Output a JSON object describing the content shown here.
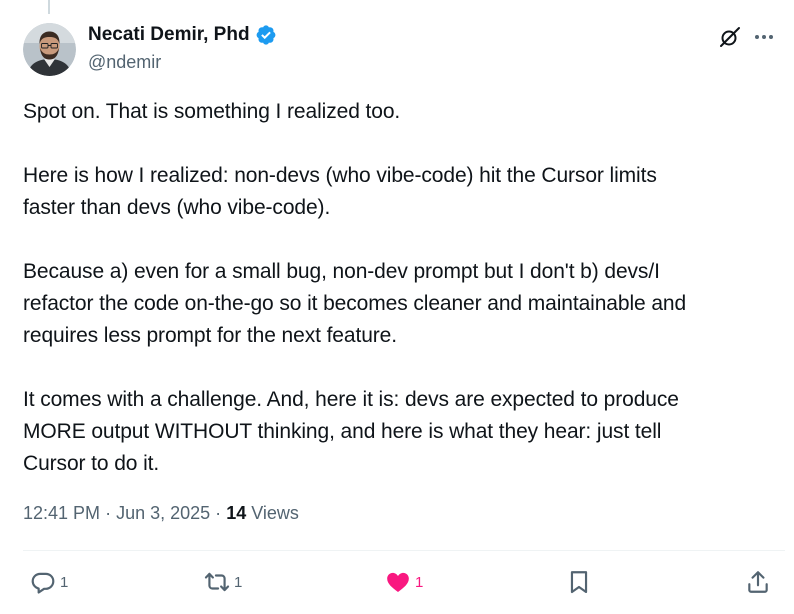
{
  "author": {
    "display_name": "Necati Demir, Phd",
    "handle": "@ndemir",
    "verified": true
  },
  "tweet": {
    "paragraphs": [
      [
        "Spot on. That is something I realized too."
      ],
      [
        "Here is how I realized: non-devs (who vibe-code) hit the Cursor limits",
        "faster than devs (who vibe-code)."
      ],
      [
        "Because a) even for a small bug, non-dev prompt but I don't b) devs/I",
        "refactor the code on-the-go so it becomes cleaner and maintainable and",
        "requires less prompt for the next feature."
      ],
      [
        "It comes with a challenge. And, here it is: devs are expected to produce",
        "MORE output WITHOUT thinking, and here is what they hear: just tell",
        "Cursor to do it."
      ]
    ]
  },
  "meta": {
    "time": "12:41 PM",
    "separator": "·",
    "date": "Jun 3, 2025",
    "views_count": "14",
    "views_label": "Views"
  },
  "actions": {
    "reply_count": "1",
    "repost_count": "1",
    "like_count": "1"
  },
  "colors": {
    "accent": "#1d9bf0",
    "like": "#f91880",
    "secondary_text": "#536471",
    "primary_text": "#0f1419"
  },
  "icons": {
    "verified": "verified-badge-icon",
    "grok": "grok-icon",
    "more": "more-icon",
    "reply": "reply-icon",
    "repost": "repost-icon",
    "like": "heart-icon",
    "bookmark": "bookmark-icon",
    "share": "share-icon"
  }
}
